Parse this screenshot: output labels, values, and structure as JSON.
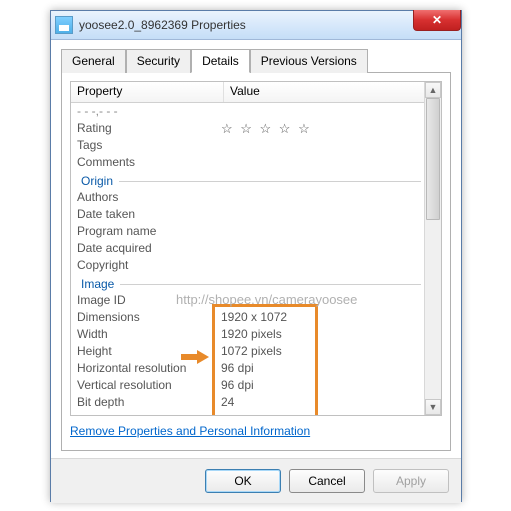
{
  "window": {
    "title": "yoosee2.0_8962369 Properties"
  },
  "tabs": [
    "General",
    "Security",
    "Details",
    "Previous Versions"
  ],
  "activeTab": "Details",
  "columns": {
    "prop": "Property",
    "val": "Value"
  },
  "rows": {
    "rating": "Rating",
    "tags": "Tags",
    "comments": "Comments",
    "origin": "Origin",
    "authors": "Authors",
    "dateTaken": "Date taken",
    "programName": "Program name",
    "dateAcquired": "Date acquired",
    "copyright": "Copyright",
    "image": "Image",
    "imageID": "Image ID",
    "dimensions": "Dimensions",
    "width": "Width",
    "height": "Height",
    "hres": "Horizontal resolution",
    "vres": "Vertical resolution",
    "bitdepth": "Bit depth"
  },
  "values": {
    "dimensions": "1920 x 1072",
    "width": "1920 pixels",
    "height": "1072 pixels",
    "hres": "96 dpi",
    "vres": "96 dpi",
    "bitdepth": "24"
  },
  "link": "Remove Properties and Personal Information",
  "buttons": {
    "ok": "OK",
    "cancel": "Cancel",
    "apply": "Apply"
  },
  "watermark": "http://shopee.vn/camerayoosee",
  "stars": "☆ ☆ ☆ ☆ ☆"
}
